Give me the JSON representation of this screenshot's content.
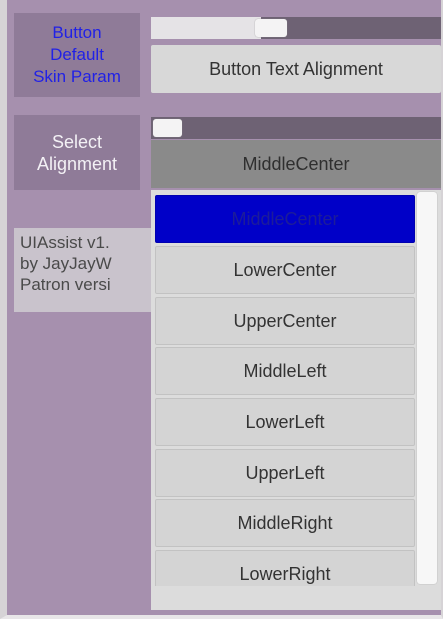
{
  "skin_param": {
    "label_lines": [
      "Button",
      "Default",
      "Skin Param"
    ],
    "slider_value_fraction": 0.38,
    "button_label": "Button Text Alignment"
  },
  "alignment": {
    "label_lines": [
      "Select",
      "Alignment"
    ],
    "slider_value_fraction": 0.0,
    "selected_value": "MiddleCenter",
    "options": [
      "MiddleCenter",
      "LowerCenter",
      "UpperCenter",
      "MiddleLeft",
      "LowerLeft",
      "UpperLeft",
      "MiddleRight",
      "LowerRight"
    ],
    "selected_index": 0
  },
  "info": {
    "lines": [
      "UIAssist v1.",
      "by JayJayW",
      "Patron versi"
    ]
  },
  "colors": {
    "background": "#a690ae",
    "label_blue": "#2121e6",
    "selected_option": "#0000c8"
  }
}
